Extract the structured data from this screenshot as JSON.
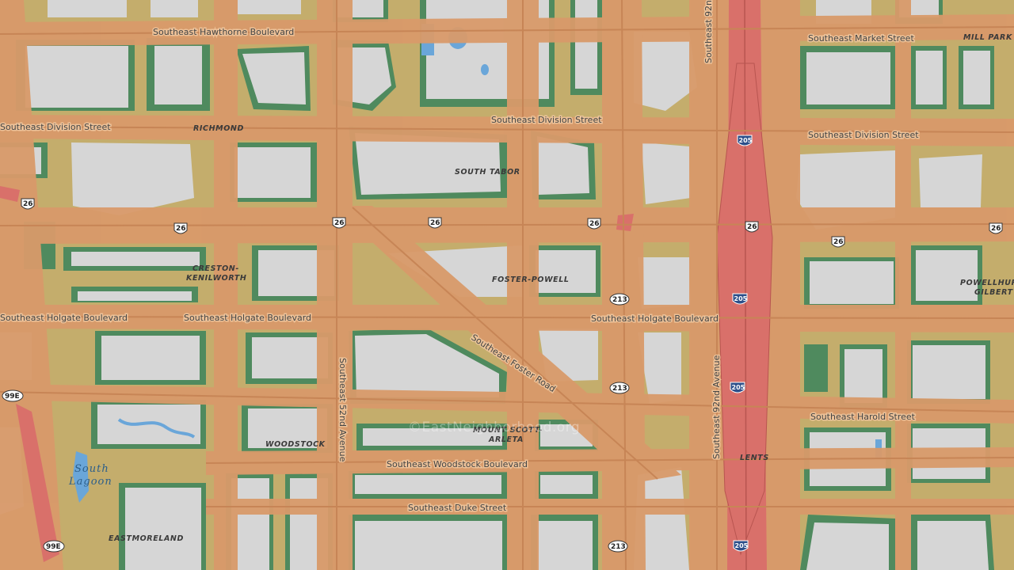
{
  "map": {
    "watermark": "©EastNeighborhood.org",
    "colors": {
      "base": "#c9a96e",
      "low_noise": "#c7b36a",
      "mid_noise": "#d99a6a",
      "high_noise": "#d9706a",
      "quiet": "#4f8a5e",
      "block": "#d9d9d9",
      "water": "#6aa6d9"
    },
    "streets": {
      "hawthorne": "Southeast Hawthorne Boulevard",
      "market": "Southeast Market Street",
      "division_w": "Southeast Division Street",
      "division_c": "Southeast Division Street",
      "division_e": "Southeast Division Street",
      "holgate_w": "Southeast Holgate Boulevard",
      "holgate_c": "Southeast Holgate Boulevard",
      "holgate_e": "Southeast Holgate Boulevard",
      "foster": "Southeast Foster Road",
      "harold": "Southeast Harold Street",
      "woodstock": "Southeast Woodstock Boulevard",
      "duke": "Southeast Duke Street",
      "ave52": "Southeast 52nd Avenue",
      "ave92_n": "Southeast 92nd Avenue",
      "ave92_s": "Southeast 92nd Avenue"
    },
    "neighborhoods": {
      "richmond": "RICHMOND",
      "south_tabor": "SOUTH TABOR",
      "creston_1": "CRESTON-",
      "creston_2": "KENILWORTH",
      "foster_powell": "FOSTER-POWELL",
      "woodstock": "WOODSTOCK",
      "mount_scott_1": "MOUNT SCOTT-",
      "mount_scott_2": "ARLETA",
      "lents": "LENTS",
      "eastmoreland": "EASTMORELAND",
      "mill_park": "MILL PARK",
      "powellhurst_1": "POWELLHURST-",
      "powellhurst_2": "GILBERT"
    },
    "water": {
      "south_lagoon_1": "South",
      "south_lagoon_2": "Lagoon"
    },
    "shields": {
      "us26": "26",
      "i205": "205",
      "or213": "213",
      "or99e": "99E"
    }
  }
}
